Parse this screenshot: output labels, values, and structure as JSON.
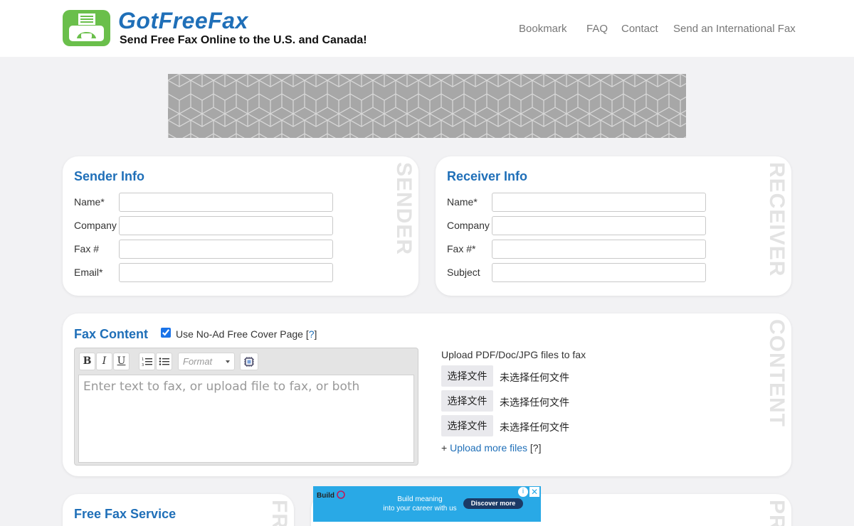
{
  "header": {
    "brand": "GotFreeFax",
    "tagline": "Send Free Fax Online to the U.S. and Canada!",
    "nav": [
      "Bookmark",
      "FAQ",
      "Contact",
      "Send an International Fax"
    ]
  },
  "sender": {
    "title": "Sender Info",
    "side_label": "SENDER",
    "fields": [
      {
        "label": "Name*",
        "value": ""
      },
      {
        "label": "Company",
        "value": ""
      },
      {
        "label": "Fax #",
        "value": ""
      },
      {
        "label": "Email*",
        "value": ""
      }
    ]
  },
  "receiver": {
    "title": "Receiver Info",
    "side_label": "RECEIVER",
    "fields": [
      {
        "label": "Name*",
        "value": ""
      },
      {
        "label": "Company",
        "value": ""
      },
      {
        "label": "Fax #*",
        "value": ""
      },
      {
        "label": "Subject",
        "value": ""
      }
    ]
  },
  "content": {
    "title": "Fax Content",
    "side_label": "CONTENT",
    "cover_page_label": "Use No-Ad Free Cover Page [",
    "cover_page_q": "?",
    "cover_page_end": "]",
    "cover_page_checked": true,
    "toolbar": {
      "bold": "B",
      "italic": "I",
      "underline": "U",
      "format_placeholder": "Format"
    },
    "editor_placeholder": "Enter text to fax, or upload file to fax, or both",
    "upload_label": "Upload PDF/Doc/JPG files to fax",
    "file_button": "选择文件",
    "file_none": "未选择任何文件",
    "upload_more_prefix": "+ ",
    "upload_more_link": "Upload more files",
    "upload_more_q": "[?]"
  },
  "bottom": {
    "free_title": "Free Fax Service",
    "free_side": "FR",
    "pro_side": "PR"
  },
  "ad2": {
    "logo": "Build",
    "line1": "Build meaning",
    "line2": "into your career with us",
    "button": "Discover more",
    "info": "i",
    "close": "✕"
  },
  "colors": {
    "brand_blue": "#1f6fb8",
    "logo_green": "#6abf4b",
    "page_bg": "#f2f2f4"
  }
}
